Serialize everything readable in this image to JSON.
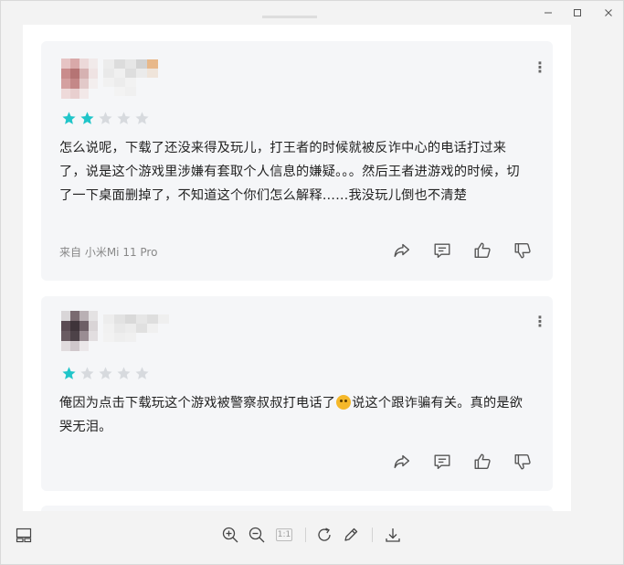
{
  "window": {
    "controls": {
      "minimize_icon": "minimize-icon",
      "maximize_icon": "maximize-icon",
      "close_icon": "close-icon"
    }
  },
  "reviews": [
    {
      "rating": 2,
      "max_rating": 5,
      "text": "怎么说呢，下载了还没来得及玩儿，打王者的时候就被反诈中心的电话打过来了，说是这个游戏里涉嫌有套取个人信息的嫌疑。。。然后王者进游戏的时候，切了一下桌面删掉了，不知道这个你们怎么解释……我没玩儿倒也不清楚",
      "source": "来自 小米Mi 11 Pro"
    },
    {
      "rating": 1,
      "max_rating": 5,
      "text_before_emoji": "俺因为点击下载玩这个游戏被警察叔叔打电话了",
      "text_after_emoji": "说这个跟诈骗有关。真的是欲哭无泪。",
      "emoji": "upside-down-face"
    }
  ],
  "colors": {
    "star_filled": "#20c5c9",
    "star_empty": "#d7dade",
    "card_bg": "#f5f6f8",
    "page_bg": "#f3f3f3"
  },
  "toolbar": {
    "icons": [
      "thumbnail-panel-icon",
      "zoom-in-icon",
      "zoom-out-icon",
      "actual-size-icon",
      "rotate-icon",
      "edit-icon",
      "download-icon"
    ],
    "actual_size_label": "1:1"
  }
}
